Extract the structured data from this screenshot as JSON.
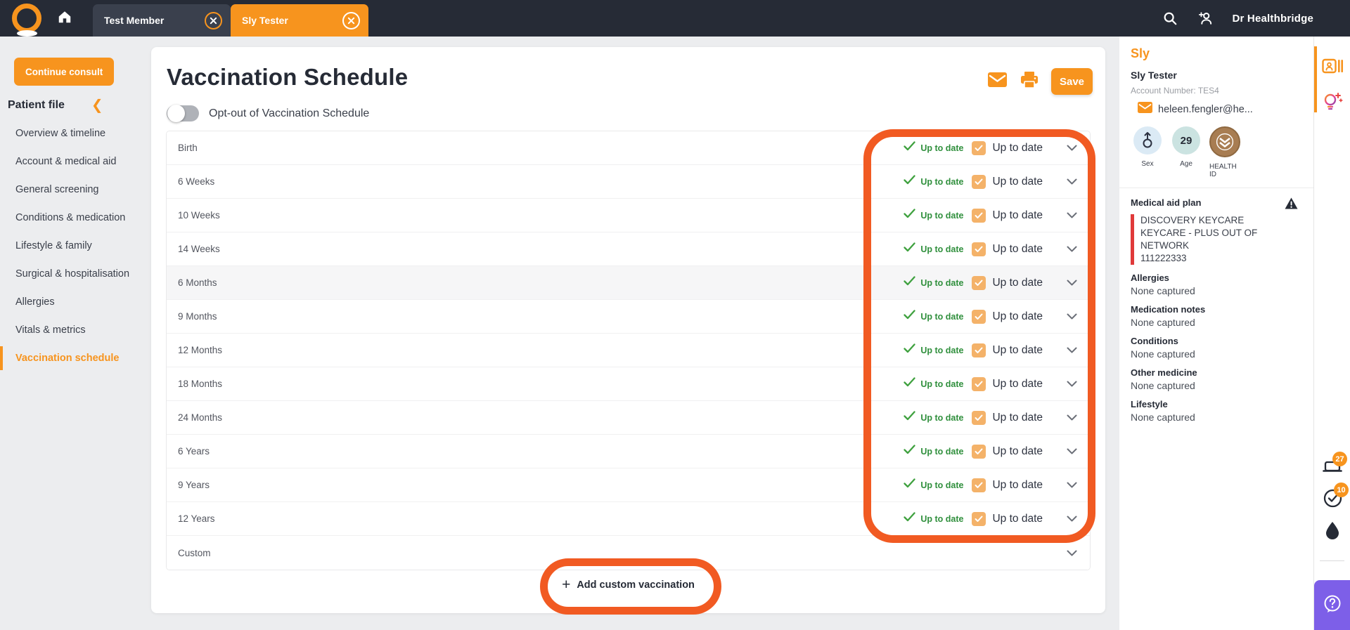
{
  "navbar": {
    "tabs": [
      {
        "label": "Test Member",
        "active": false
      },
      {
        "label": "Sly Tester",
        "active": true
      }
    ],
    "user": "Dr Healthbridge"
  },
  "sidebar": {
    "continue_button": "Continue consult",
    "section_title": "Patient file",
    "items": [
      {
        "label": "Overview & timeline",
        "active": false
      },
      {
        "label": "Account & medical aid",
        "active": false
      },
      {
        "label": "General screening",
        "active": false
      },
      {
        "label": "Conditions & medication",
        "active": false
      },
      {
        "label": "Lifestyle & family",
        "active": false
      },
      {
        "label": "Surgical & hospitalisation",
        "active": false
      },
      {
        "label": "Allergies",
        "active": false
      },
      {
        "label": "Vitals & metrics",
        "active": false
      },
      {
        "label": "Vaccination schedule",
        "active": true
      }
    ]
  },
  "main": {
    "title": "Vaccination Schedule",
    "save_label": "Save",
    "optout_label": "Opt-out of Vaccination Schedule",
    "rows": [
      {
        "label": "Birth",
        "status": "Up to date",
        "checkbox_label": "Up to date",
        "shaded": false
      },
      {
        "label": "6 Weeks",
        "status": "Up to date",
        "checkbox_label": "Up to date",
        "shaded": false
      },
      {
        "label": "10 Weeks",
        "status": "Up to date",
        "checkbox_label": "Up to date",
        "shaded": false
      },
      {
        "label": "14 Weeks",
        "status": "Up to date",
        "checkbox_label": "Up to date",
        "shaded": false
      },
      {
        "label": "6 Months",
        "status": "Up to date",
        "checkbox_label": "Up to date",
        "shaded": true
      },
      {
        "label": "9 Months",
        "status": "Up to date",
        "checkbox_label": "Up to date",
        "shaded": false
      },
      {
        "label": "12 Months",
        "status": "Up to date",
        "checkbox_label": "Up to date",
        "shaded": false
      },
      {
        "label": "18 Months",
        "status": "Up to date",
        "checkbox_label": "Up to date",
        "shaded": false
      },
      {
        "label": "24 Months",
        "status": "Up to date",
        "checkbox_label": "Up to date",
        "shaded": false
      },
      {
        "label": "6 Years",
        "status": "Up to date",
        "checkbox_label": "Up to date",
        "shaded": false
      },
      {
        "label": "9 Years",
        "status": "Up to date",
        "checkbox_label": "Up to date",
        "shaded": false
      },
      {
        "label": "12 Years",
        "status": "Up to date",
        "checkbox_label": "Up to date",
        "shaded": false
      }
    ],
    "custom_row_label": "Custom",
    "add_custom_label": "Add custom vaccination"
  },
  "patient_panel": {
    "short_name": "Sly",
    "full_name": "Sly Tester",
    "account_number": "Account Number: TES4",
    "email": "heleen.fengler@he...",
    "badges": {
      "sex_label": "Sex",
      "age_label": "Age",
      "age_value": "29",
      "healthid_label": "HEALTH ID"
    },
    "medical_aid": {
      "heading": "Medical aid plan",
      "lines": [
        "DISCOVERY KEYCARE",
        "KEYCARE - PLUS OUT OF",
        "NETWORK",
        "111222333"
      ]
    },
    "sections": [
      {
        "heading": "Allergies",
        "value": "None captured"
      },
      {
        "heading": "Medication notes",
        "value": "None captured"
      },
      {
        "heading": "Conditions",
        "value": "None captured"
      },
      {
        "heading": "Other medicine",
        "value": "None captured"
      },
      {
        "heading": "Lifestyle",
        "value": "None captured"
      }
    ]
  },
  "toolbar": {
    "tray_badge": "27",
    "check_badge": "10"
  },
  "colors": {
    "accent_orange": "#F7941E",
    "annotation_orange": "#F15A22",
    "status_green": "#2F8F3C",
    "checkbox_orange": "#F4B269",
    "navbar_dark": "#262B36",
    "help_purple": "#7D5FE8",
    "plan_red": "#E03A3A"
  }
}
